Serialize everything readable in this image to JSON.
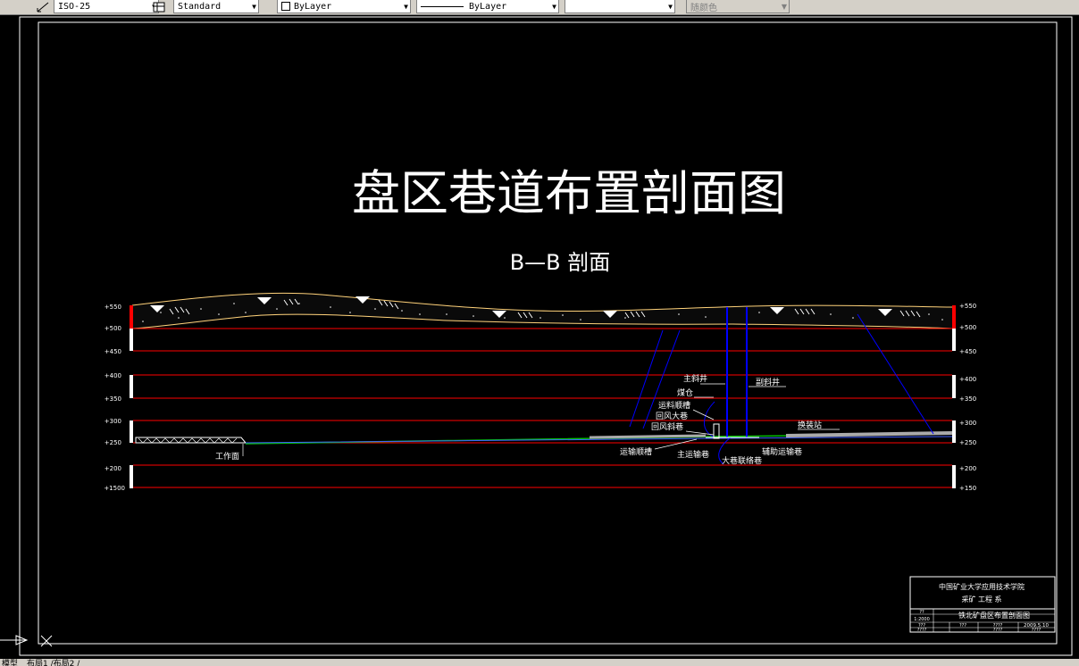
{
  "toolbar": {
    "dimstyle": "ISO-25",
    "tablestyle": "Standard",
    "layer": "ByLayer",
    "linetype": "ByLayer",
    "lineweight": "",
    "plotstyle": "随颜色"
  },
  "drawing": {
    "title": "盘区巷道布置剖面图",
    "subtitle": "B—B 剖面",
    "elev_left": [
      "+550",
      "+500",
      "+450",
      "+400",
      "+350",
      "+300",
      "+250",
      "+200",
      "+1500"
    ],
    "elev_right": [
      "+550",
      "+500",
      "+450",
      "+400",
      "+350",
      "+300",
      "+250",
      "+200",
      "+150"
    ],
    "labels": {
      "main_shaft": "主斜井",
      "aux_shaft": "副斜井",
      "coal_bin": "煤仓",
      "haul_chute": "运料顺槽",
      "return_roadway": "回风大巷",
      "return_incline": "回风斜巷",
      "transport_chute": "运输顺槽",
      "main_haulage": "主运输巷",
      "big_connect": "大巷联络巷",
      "aux_haulage": "辅助运输巷",
      "transfer_station": "换装站",
      "working_face": "工作面"
    }
  },
  "title_block": {
    "institution": "中国矿业大学应用技术学院",
    "department": "采矿 工程 系",
    "drawing_name": "铁北矿盘区布置剖面图",
    "scale": "1:2000",
    "code_a": "??",
    "code_b": "???",
    "code_c": "????",
    "date": "2009.5.10",
    "rev_a": "????",
    "rev_b": "????",
    "rev_c": "????"
  },
  "status": {
    "model_tab": "模型",
    "layout_tabs": "布局1 /布局2 /"
  },
  "colors": {
    "background": "#000000",
    "toolbar": "#d4d0c8",
    "elevation_lines": "#ff0000",
    "shaft": "#0000ff",
    "surface": "#ffd27a"
  }
}
